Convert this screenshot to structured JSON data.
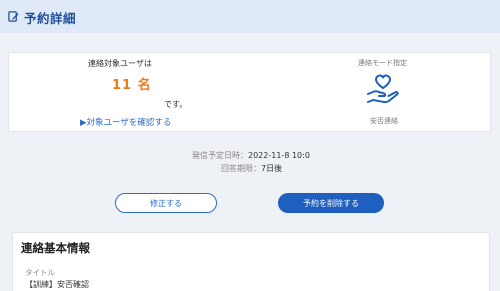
{
  "header": {
    "title": "予約詳細",
    "icon": "edit-document-icon"
  },
  "summary": {
    "target_users_label": "連絡対象ユーザは",
    "count_text": "11 名",
    "suffix": "です。",
    "confirm_link": "▶対象ユーザを確認する",
    "mode_label": "連絡モード指定",
    "mode_icon": "heart-hand-icon",
    "mode_value": "安否連絡"
  },
  "schedule": {
    "send_label": "発信予定日時：",
    "send_value": "2022-11-8 10:0",
    "deadline_label": "回答期限：",
    "deadline_value": "7日後"
  },
  "actions": {
    "edit_label": "修正する",
    "delete_label": "予約を削除する"
  },
  "basic_info": {
    "section_title": "連絡基本情報",
    "title_label": "タイトル",
    "title_value": "【訓練】安否確認"
  },
  "colors": {
    "accent": "#1f5fbf",
    "count": "#f07a1a",
    "header_bg": "#dfe9f7"
  }
}
